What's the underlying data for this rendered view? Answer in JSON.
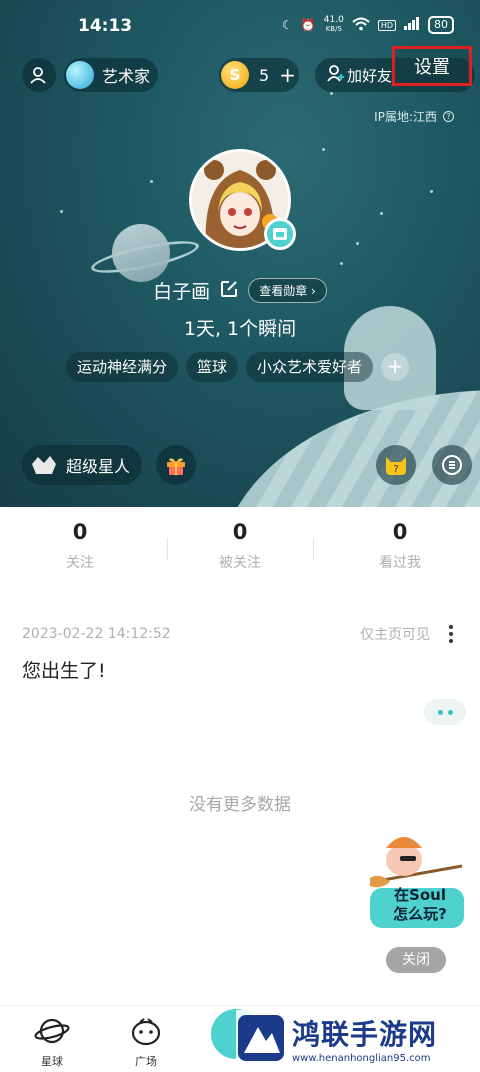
{
  "status_bar": {
    "time": "14:13",
    "net_speed_value": "41.0",
    "net_speed_unit": "KB/S",
    "battery": "80"
  },
  "header": {
    "role_label": "艺术家",
    "coins": "5",
    "add_friend_label": "加好友",
    "settings_label": "设置",
    "ip_location": "IP属地:江西"
  },
  "profile": {
    "username": "白子画",
    "badges_button": "查看勋章",
    "days_moments": "1天, 1个瞬间",
    "tags": [
      "运动神经满分",
      "篮球",
      "小众艺术爱好者"
    ],
    "super_star_label": "超级星人"
  },
  "stats": [
    {
      "value": "0",
      "label": "关注"
    },
    {
      "value": "0",
      "label": "被关注"
    },
    {
      "value": "0",
      "label": "看过我"
    }
  ],
  "post": {
    "timestamp": "2023-02-22 14:12:52",
    "visibility": "仅主页可见",
    "text": "您出生了!"
  },
  "feed_end": "没有更多数据",
  "howto": {
    "line1": "在Soul",
    "line2": "怎么玩?",
    "close_label": "关闭"
  },
  "tabbar": {
    "planet": "星球",
    "square": "广场"
  },
  "watermark": {
    "title": "鸿联手游网",
    "url": "www.henanhonglian95.com"
  },
  "colors": {
    "accent": "#2bc8c7",
    "highlight_box": "#e02020",
    "hero_bg": "#1f5b65"
  }
}
